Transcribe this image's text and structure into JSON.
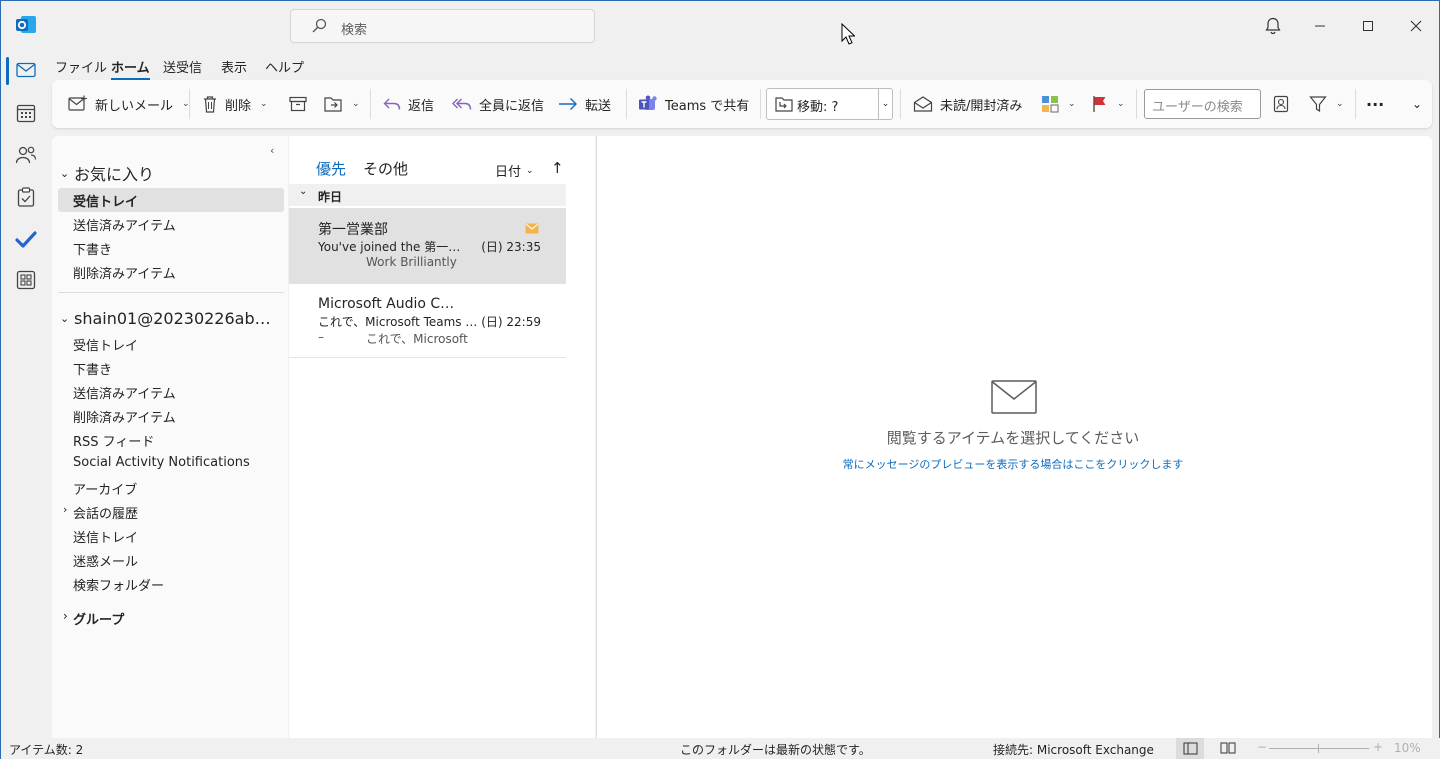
{
  "titlebar": {
    "search_placeholder": "検索"
  },
  "menu": {
    "items": [
      "ファイル",
      "ホーム",
      "送受信",
      "表示",
      "ヘルプ"
    ],
    "active_index": 1
  },
  "ribbon": {
    "new_mail": "新しいメール",
    "delete": "削除",
    "reply": "返信",
    "reply_all": "全員に返信",
    "forward": "転送",
    "teams_share": "Teams で共有",
    "move": "移動: ?",
    "unread_read": "未読/開封済み",
    "people_search_placeholder": "ユーザーの検索",
    "more": "···"
  },
  "folders": {
    "favorites": {
      "header": "お気に入り",
      "items": [
        "受信トレイ",
        "送信済みアイテム",
        "下書き",
        "削除済みアイテム"
      ],
      "selected_index": 0
    },
    "account": {
      "header": "shain01@20230226ab…",
      "items": [
        "受信トレイ",
        "下書き",
        "送信済みアイテム",
        "削除済みアイテム",
        "RSS フィード",
        "Social Activity Notifications",
        "アーカイブ",
        "会話の履歴",
        "送信トレイ",
        "迷惑メール",
        "検索フォルダー"
      ]
    },
    "groups": "グループ"
  },
  "message_list": {
    "tab_focused": "優先",
    "tab_other": "その他",
    "sort_label": "日付",
    "group_header": "昨日",
    "messages": [
      {
        "from": "第一営業部",
        "subject": "You've joined the 第一…",
        "time": "(日) 23:35",
        "preview": "Work Brilliantly",
        "unread_icon": "envelope-icon",
        "selected": true
      },
      {
        "from": "Microsoft Audio C…",
        "subject": "これで、Microsoft Teams …",
        "time": "(日) 22:59",
        "preview_prefix": "–",
        "preview": "これで、Microsoft",
        "selected": false
      }
    ]
  },
  "reading_pane": {
    "empty_title": "閲覧するアイテムを選択してください",
    "preview_link": "常にメッセージのプレビューを表示する場合はここをクリックします"
  },
  "status": {
    "item_count": "アイテム数: 2",
    "folder_status": "このフォルダーは最新の状態です。",
    "connection": "接続先: Microsoft Exchange",
    "zoom": "10%"
  },
  "colors": {
    "accent": "#0f6cbd",
    "selected_row": "#e1e1e1",
    "flag_red": "#d13438",
    "unread_envelope": "#f2b54c"
  }
}
